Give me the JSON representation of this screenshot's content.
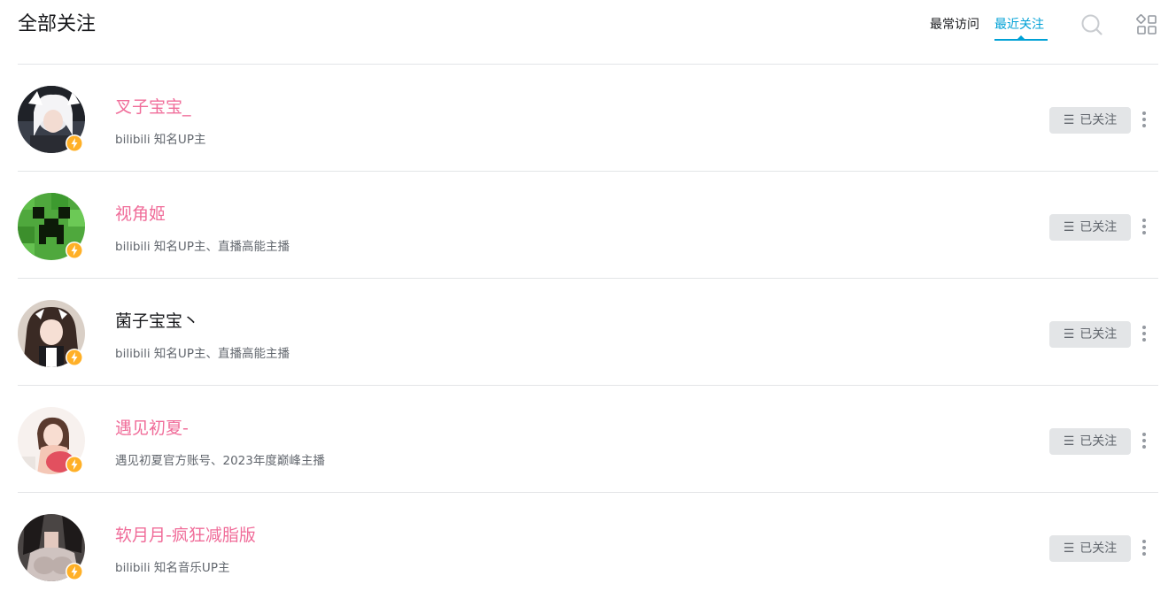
{
  "header": {
    "title": "全部关注",
    "tabs": [
      {
        "label": "最常访问",
        "active": false
      },
      {
        "label": "最近关注",
        "active": true
      }
    ],
    "search_icon": "search-icon",
    "layout_icon": "layout-grid-icon",
    "accent_color": "#00a1d6"
  },
  "list": {
    "follow_label": "已关注",
    "follow_icon": "menu-icon",
    "more_icon": "more-vertical-icon",
    "badge_icon": "lightning-badge-icon",
    "vip_name_color": "#f06c99",
    "items": [
      {
        "name": "叉子宝宝_",
        "desc": "bilibili 知名UP主",
        "vip": true
      },
      {
        "name": "视角姬",
        "desc": "bilibili 知名UP主、直播高能主播",
        "vip": true
      },
      {
        "name": "菌子宝宝丶",
        "desc": "bilibili 知名UP主、直播高能主播",
        "vip": false
      },
      {
        "name": "遇见初夏-",
        "desc": "遇见初夏官方账号、2023年度巅峰主播",
        "vip": true
      },
      {
        "name": "软月月-疯狂减脂版",
        "desc": "bilibili 知名音乐UP主",
        "vip": true
      }
    ]
  }
}
